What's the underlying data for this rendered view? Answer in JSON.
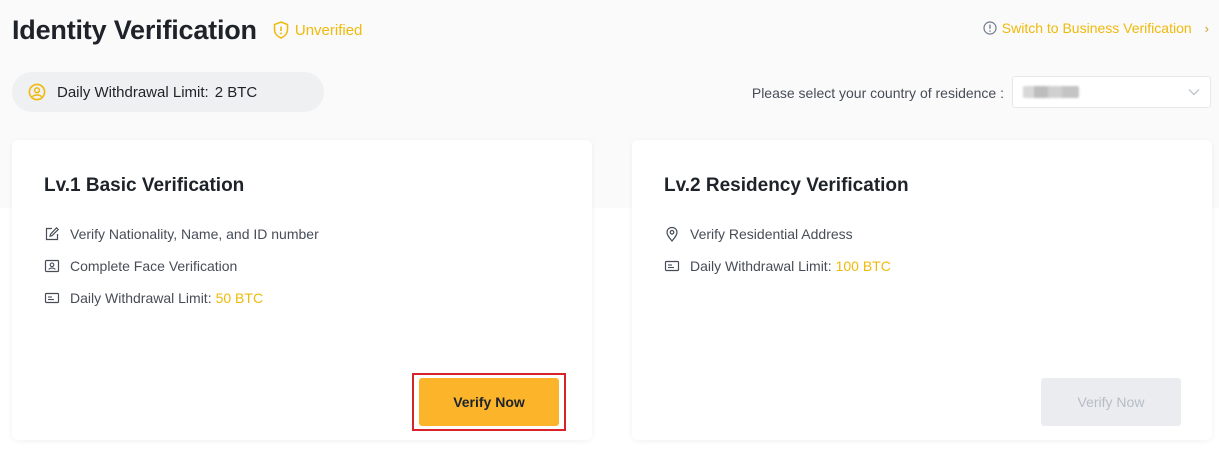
{
  "header": {
    "title": "Identity Verification",
    "status": "Unverified",
    "switch_link": "Switch to Business Verification"
  },
  "limit": {
    "label": "Daily Withdrawal Limit:",
    "value": "2 BTC"
  },
  "country": {
    "label": "Please select your country of residence :",
    "selected_value": "██████"
  },
  "levels": [
    {
      "title": "Lv.1 Basic Verification",
      "features": [
        {
          "icon": "edit-icon",
          "text": "Verify Nationality, Name, and ID number"
        },
        {
          "icon": "face-id-icon",
          "text": "Complete Face Verification"
        },
        {
          "icon": "card-icon",
          "text": "Daily Withdrawal Limit:",
          "highlight": "50 BTC"
        }
      ],
      "button": "Verify Now",
      "button_enabled": true
    },
    {
      "title": "Lv.2 Residency Verification",
      "features": [
        {
          "icon": "location-pin-icon",
          "text": "Verify Residential Address"
        },
        {
          "icon": "card-icon",
          "text": "Daily Withdrawal Limit:",
          "highlight": "100 BTC"
        }
      ],
      "button": "Verify Now",
      "button_enabled": false
    }
  ],
  "colors": {
    "accent": "#f0b90b",
    "button": "#fcb52b",
    "annotation_box": "#d9232b"
  }
}
